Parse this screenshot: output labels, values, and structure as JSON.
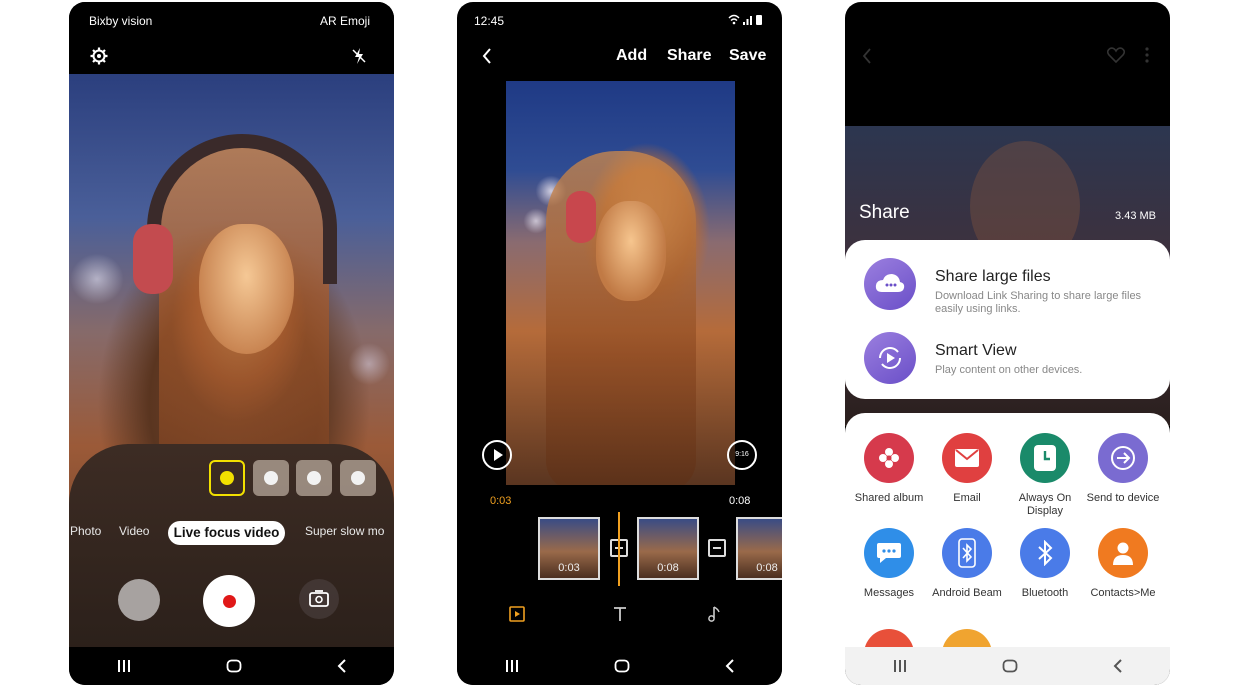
{
  "phone1": {
    "top_left_label": "Bixby vision",
    "top_right_label": "AR Emoji",
    "modes": [
      "Photo",
      "Video",
      "Live focus video",
      "Super slow mo"
    ],
    "selected_mode": "Live focus video"
  },
  "phone2": {
    "status_time": "12:45",
    "toolbar": {
      "add": "Add",
      "share": "Share",
      "save": "Save"
    },
    "aspect_ratio": "9:16",
    "time_start": "0:03",
    "time_end": "0:08",
    "clip_durations": [
      "0:03",
      "0:08",
      "0:08"
    ],
    "accent_color": "#f0a020"
  },
  "phone3": {
    "title": "Share",
    "file_size": "3.43 MB",
    "options": [
      {
        "title": "Share large files",
        "subtitle": "Download Link Sharing to share large files easily using links."
      },
      {
        "title": "Smart View",
        "subtitle": "Play content on other devices."
      }
    ],
    "apps": [
      {
        "label": "Shared album",
        "color": "#d63a4c",
        "icon": "flower-icon"
      },
      {
        "label": "Email",
        "color": "#e04040",
        "icon": "envelope-icon"
      },
      {
        "label": "Always On Display",
        "color": "#1a8a6a",
        "icon": "clock-icon"
      },
      {
        "label": "Send to device",
        "color": "#7a6bd1",
        "icon": "send-icon"
      },
      {
        "label": "Messages",
        "color": "#2f8ee8",
        "icon": "chat-icon"
      },
      {
        "label": "Android Beam",
        "color": "#4a7be8",
        "icon": "bluetooth-icon"
      },
      {
        "label": "Bluetooth",
        "color": "#4a7be8",
        "icon": "bluetooth-icon"
      },
      {
        "label": "Contacts>Me",
        "color": "#f07a20",
        "icon": "person-icon"
      }
    ]
  }
}
